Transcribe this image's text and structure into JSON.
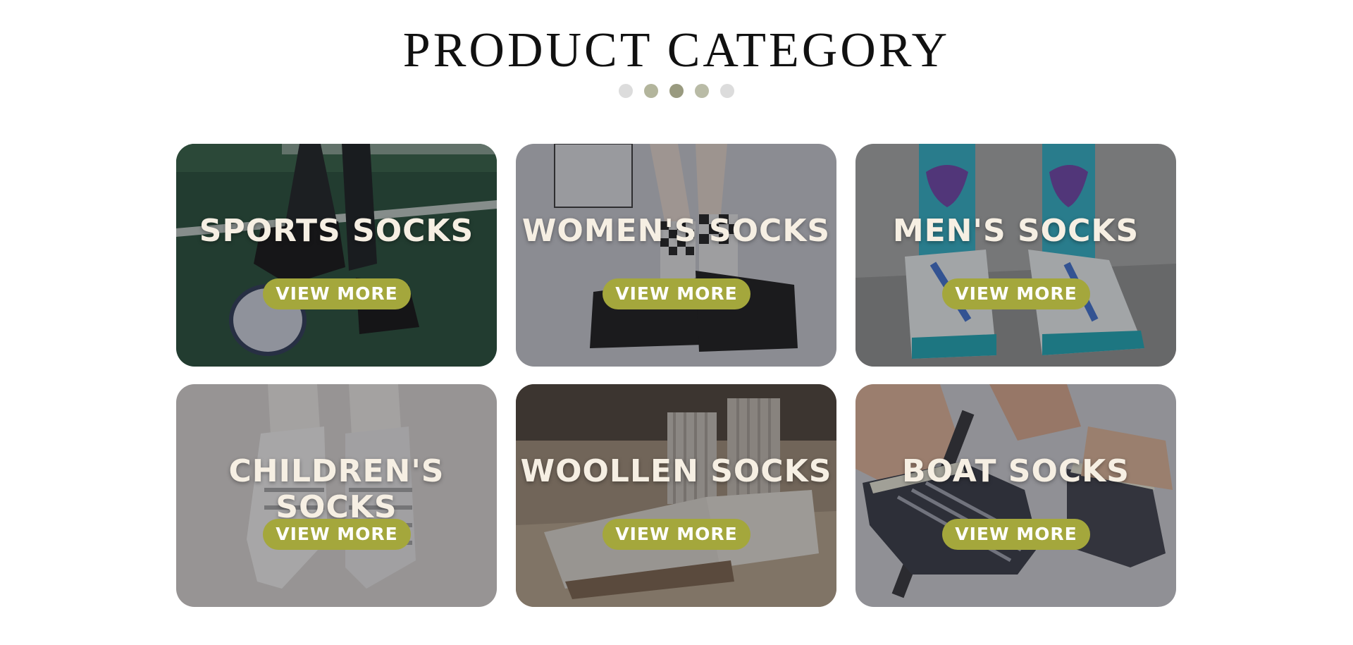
{
  "section": {
    "title": "PRODUCT CATEGORY",
    "carousel_dots": [
      {
        "color": "#dcdcdc",
        "active": false
      },
      {
        "color": "#b3b59c",
        "active": false
      },
      {
        "color": "#999a7f",
        "active": true
      },
      {
        "color": "#b9bba6",
        "active": false
      },
      {
        "color": "#dcdcdc",
        "active": false
      }
    ]
  },
  "button_color": "#a4a73c",
  "categories": [
    {
      "label": "SPORTS SOCKS",
      "button": "VIEW MORE",
      "image": "sports-socks-photo"
    },
    {
      "label": "WOMEN'S SOCKS",
      "button": "VIEW MORE",
      "image": "womens-socks-photo"
    },
    {
      "label": "MEN'S SOCKS",
      "button": "VIEW MORE",
      "image": "mens-socks-photo"
    },
    {
      "label": "CHILDREN'S SOCKS",
      "button": "VIEW MORE",
      "image": "childrens-socks-photo"
    },
    {
      "label": "WOOLLEN SOCKS",
      "button": "VIEW MORE",
      "image": "woollen-socks-photo"
    },
    {
      "label": "BOAT SOCKS",
      "button": "VIEW MORE",
      "image": "boat-socks-photo"
    }
  ]
}
